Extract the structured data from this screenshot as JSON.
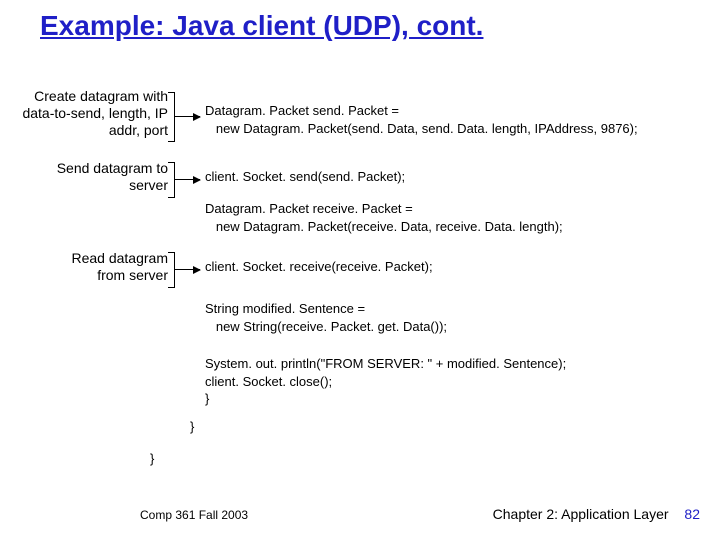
{
  "title": "Example: Java client (UDP), cont.",
  "annotations": {
    "a1": "Create datagram\nwith data-to-send,\nlength, IP addr, port",
    "a2": "Send datagram\nto server",
    "a3": "Read datagram\nfrom server"
  },
  "code": {
    "c1": "Datagram. Packet send. Packet =\n   new Datagram. Packet(send. Data, send. Data. length, IPAddress, 9876);",
    "c2": "client. Socket. send(send. Packet);",
    "c3": "Datagram. Packet receive. Packet =\n   new Datagram. Packet(receive. Data, receive. Data. length);",
    "c4": "client. Socket. receive(receive. Packet);",
    "c5": "String modified. Sentence =\n   new String(receive. Packet. get. Data());",
    "c6": "System. out. println(\"FROM SERVER: \" + modified. Sentence);\nclient. Socket. close();\n}",
    "c7": "}",
    "c8": "}"
  },
  "footer": {
    "left": "Comp 361   Fall 2003",
    "right": "Chapter 2: Application Layer",
    "page": "82"
  }
}
